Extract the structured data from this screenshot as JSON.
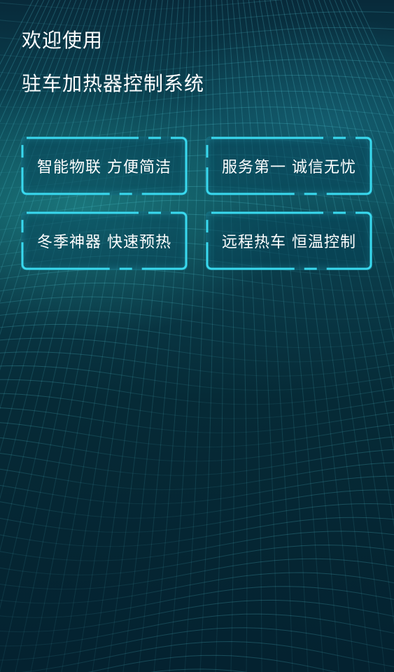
{
  "header": {
    "welcome": "欢迎使用",
    "system_title": "驻车加热器控制系统"
  },
  "cards": [
    {
      "label": "智能物联 方便简洁"
    },
    {
      "label": "服务第一 诚信无忧"
    },
    {
      "label": "冬季神器 快速预热"
    },
    {
      "label": "远程热车 恒温控制"
    }
  ],
  "colors": {
    "frame_accent": "#39d9ee",
    "background_dark": "#04202c",
    "background_teal": "#0d4e5a"
  }
}
